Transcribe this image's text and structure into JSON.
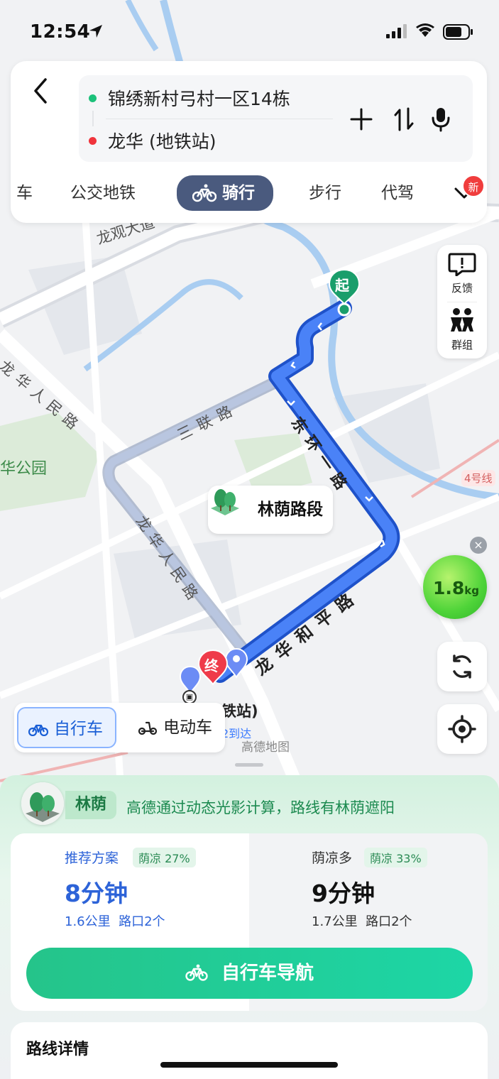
{
  "status_bar": {
    "time": "12:54"
  },
  "search": {
    "from": "锦绣新村弓村一区14栋",
    "to": "龙华 (地铁站)"
  },
  "modes": {
    "tabs": [
      {
        "label": "车"
      },
      {
        "label": "公交地铁"
      },
      {
        "label": "骑行"
      },
      {
        "label": "步行"
      },
      {
        "label": "代驾"
      }
    ],
    "new_badge": "新"
  },
  "map": {
    "roads": {
      "longguan": "龙观大道",
      "longhua_people_left": "龙华人民路",
      "sanlian": "三联路",
      "donghuan": "东环一路",
      "longhua_people_mid": "龙华人民路",
      "longhua_heping": "龙华和平路",
      "park": "华公园",
      "line4": "4号线"
    },
    "shade_segment_label": "林荫路段",
    "start_pin": "起",
    "end_pin": "终",
    "station_text": "铁站)",
    "arrival_text": "2到达",
    "watermark": "高德地图"
  },
  "side_buttons": {
    "feedback": "反馈",
    "group": "群组"
  },
  "carbon": {
    "value": "1.8",
    "unit": "kg"
  },
  "vehicle_toggle": {
    "bike": "自行车",
    "ebike": "电动车"
  },
  "sheet": {
    "shade_tag": "林荫",
    "shade_desc": "高德通过动态光影计算，路线有林荫遮阳",
    "plans": [
      {
        "name": "推荐方案",
        "tag": "荫凉 27%",
        "time": "8分钟",
        "distance": "1.6公里",
        "crossings": "路口2个"
      },
      {
        "name": "荫凉多",
        "tag": "荫凉 33%",
        "time": "9分钟",
        "distance": "1.7公里",
        "crossings": "路口2个"
      }
    ],
    "nav_button": "自行车导航",
    "details_title": "路线详情"
  },
  "colors": {
    "route_blue": "#3b74f5",
    "alt_route": "#a9b8d6",
    "accent_green": "#20c995",
    "tab_active": "#4a5a7e"
  }
}
